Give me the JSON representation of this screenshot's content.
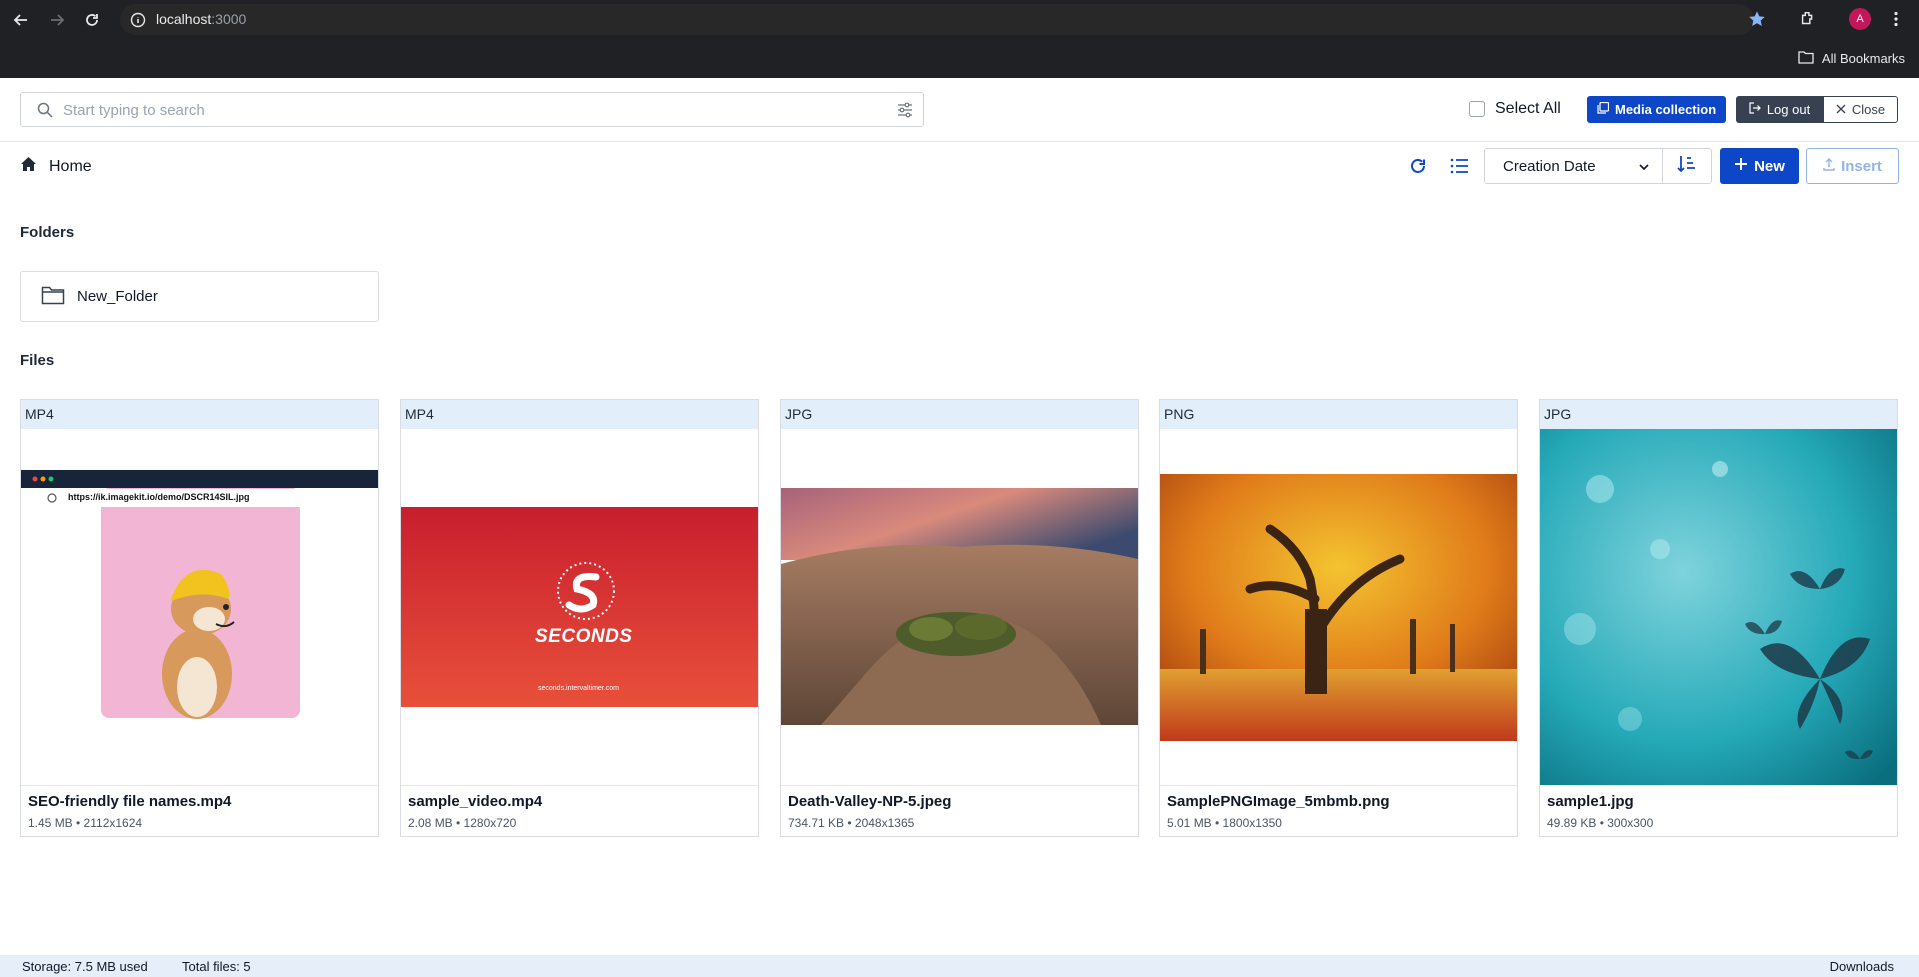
{
  "browser": {
    "url_host": "localhost",
    "url_port": ":3000",
    "avatar_letter": "A",
    "bookmarks_label": "All Bookmarks"
  },
  "toolbar": {
    "search_placeholder": "Start typing to search",
    "select_all_label": "Select All",
    "media_collection_label": "Media collection",
    "logout_label": "Log out",
    "close_label": "Close"
  },
  "nav": {
    "home_label": "Home",
    "sort_value": "Creation Date",
    "new_label": "New",
    "insert_label": "Insert"
  },
  "folders": {
    "title": "Folders",
    "items": [
      {
        "name": "New_Folder"
      }
    ]
  },
  "files": {
    "title": "Files",
    "items": [
      {
        "ext": "MP4",
        "name": "SEO-friendly file names.mp4",
        "meta": "1.45 MB • 2112x1624",
        "thumb_url_text": "https://ik.imagekit.io/demo/DSCR14SIL.jpg"
      },
      {
        "ext": "MP4",
        "name": "sample_video.mp4",
        "meta": "2.08 MB • 1280x720",
        "thumb_brand": "SECONDS",
        "thumb_site": "seconds.intervaltimer.com"
      },
      {
        "ext": "JPG",
        "name": "Death-Valley-NP-5.jpeg",
        "meta": "734.71 KB • 2048x1365"
      },
      {
        "ext": "PNG",
        "name": "SamplePNGImage_5mbmb.png",
        "meta": "5.01 MB • 1800x1350"
      },
      {
        "ext": "JPG",
        "name": "sample1.jpg",
        "meta": "49.89 KB • 300x300"
      }
    ]
  },
  "status": {
    "storage": "Storage: 7.5 MB used",
    "total": "Total files: 5",
    "downloads": "Downloads"
  },
  "colors": {
    "primary": "#0d47c7",
    "ext_bar": "#e3eefb",
    "status_bar": "#e5eef9",
    "chrome": "#202124"
  }
}
